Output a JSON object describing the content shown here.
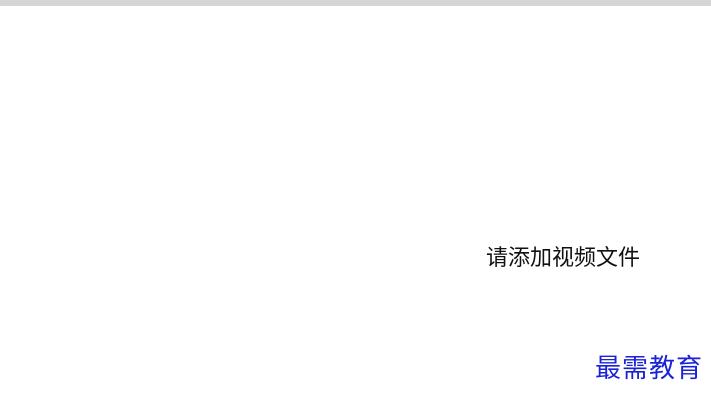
{
  "window": {
    "top_bar_color": "#d6d6d6"
  },
  "player": {
    "empty_message": "请添加视频文件",
    "background_color": "#ffffff"
  },
  "watermark": {
    "text": "最需教育",
    "color": "#1a22d6"
  }
}
